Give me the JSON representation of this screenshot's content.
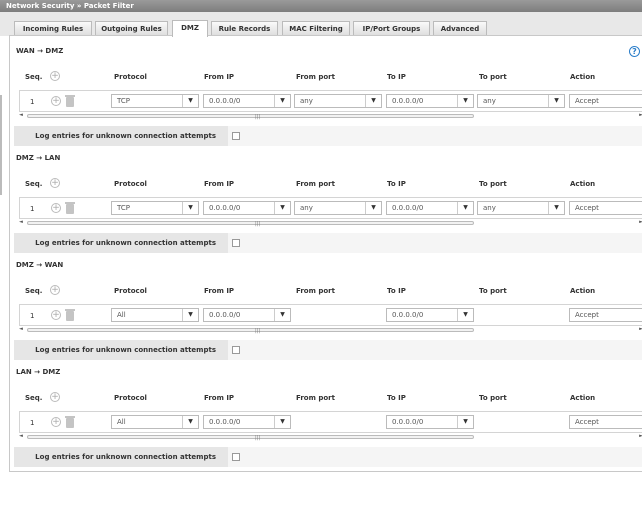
{
  "breadcrumb": "Network Security » Packet Filter",
  "tabs": [
    {
      "label": "Incoming Rules",
      "active": false
    },
    {
      "label": "Outgoing Rules",
      "active": false
    },
    {
      "label": "DMZ",
      "active": true
    },
    {
      "label": "Rule Records",
      "active": false
    },
    {
      "label": "MAC Filtering",
      "active": false
    },
    {
      "label": "IP/Port Groups",
      "active": false
    },
    {
      "label": "Advanced",
      "active": false
    }
  ],
  "help_glyph": "?",
  "headers": {
    "seq": "Seq.",
    "protocol": "Protocol",
    "from_ip": "From IP",
    "from_port": "From port",
    "to_ip": "To IP",
    "to_port": "To port",
    "action": "Action"
  },
  "log_label": "Log entries for unknown connection attempts",
  "sections": [
    {
      "title": "WAN → DMZ",
      "seq": "1",
      "protocol": "TCP",
      "from_ip": "0.0.0.0/0",
      "from_port": "any",
      "to_ip": "0.0.0.0/0",
      "to_port": "any",
      "action": "Accept"
    },
    {
      "title": "DMZ → LAN",
      "seq": "1",
      "protocol": "TCP",
      "from_ip": "0.0.0.0/0",
      "from_port": "any",
      "to_ip": "0.0.0.0/0",
      "to_port": "any",
      "action": "Accept"
    },
    {
      "title": "DMZ → WAN",
      "seq": "1",
      "protocol": "All",
      "from_ip": "0.0.0.0/0",
      "to_ip": "0.0.0.0/0",
      "action": "Accept"
    },
    {
      "title": "LAN → DMZ",
      "seq": "1",
      "protocol": "All",
      "from_ip": "0.0.0.0/0",
      "to_ip": "0.0.0.0/0",
      "action": "Accept"
    }
  ]
}
